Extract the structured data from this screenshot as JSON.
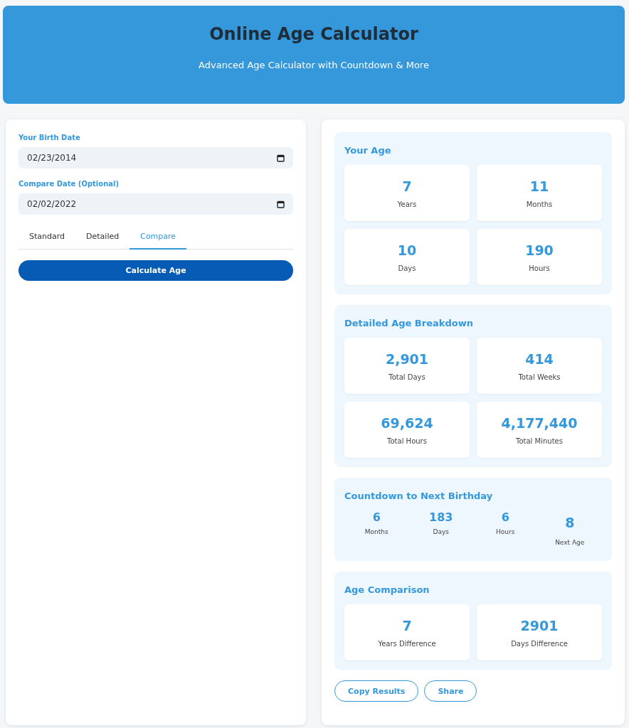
{
  "header": {
    "title": "Online Age Calculator",
    "subtitle": "Advanced Age Calculator with Countdown & More"
  },
  "form": {
    "fields": [
      {
        "label": "Your Birth Date",
        "value": "02/23/2014"
      },
      {
        "label": "Compare Date (Optional)",
        "value": "02/02/2022"
      }
    ],
    "tabs": [
      {
        "label": "Standard",
        "selected": false
      },
      {
        "label": "Detailed",
        "selected": false
      },
      {
        "label": "Compare",
        "selected": true
      }
    ],
    "button": "Calculate Age"
  },
  "sections": [
    {
      "kind": "grid",
      "title": "Your Age",
      "stats": [
        {
          "value": "7",
          "label": "Years"
        },
        {
          "value": "11",
          "label": "Months"
        },
        {
          "value": "10",
          "label": "Days"
        },
        {
          "value": "190",
          "label": "Hours"
        }
      ]
    },
    {
      "kind": "grid",
      "title": "Detailed Age Breakdown",
      "stats": [
        {
          "value": "2,901",
          "label": "Total Days"
        },
        {
          "value": "414",
          "label": "Total Weeks"
        },
        {
          "value": "69,624",
          "label": "Total Hours"
        },
        {
          "value": "4,177,440",
          "label": "Total Minutes"
        }
      ]
    },
    {
      "kind": "countdown",
      "title": "Countdown to Next Birthday",
      "stats": [
        {
          "value": "6",
          "label": "Months",
          "kind": "unit"
        },
        {
          "value": "183",
          "label": "Days",
          "kind": "unit"
        },
        {
          "value": "6",
          "label": "Hours",
          "kind": "unit"
        },
        {
          "value": "8",
          "label": "Next Age",
          "kind": "highlight"
        }
      ]
    },
    {
      "kind": "grid",
      "title": "Age Comparison",
      "stats": [
        {
          "value": "7",
          "label": "Years Difference"
        },
        {
          "value": "2901",
          "label": "Days Difference"
        }
      ]
    }
  ],
  "actions": [
    "Copy Results",
    "Share"
  ]
}
